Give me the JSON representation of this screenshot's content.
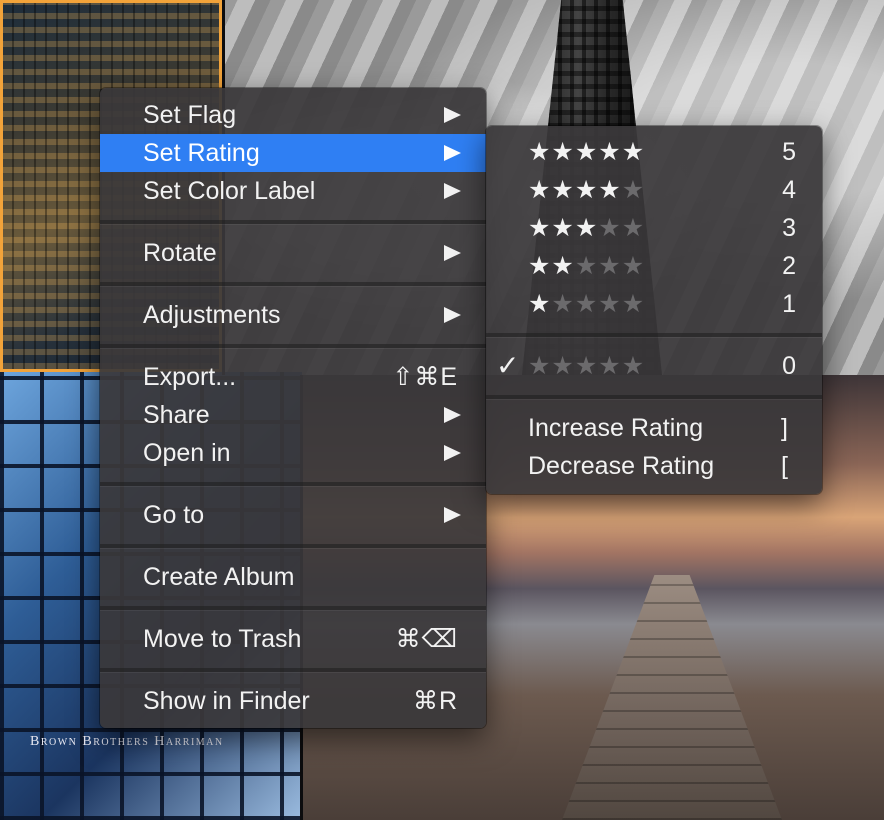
{
  "background": {
    "sign_text": "Brown Brothers Harriman",
    "accent_border": "#f2a33a"
  },
  "context_menu": {
    "items": [
      {
        "label": "Set Flag",
        "submenu": true
      },
      {
        "label": "Set Rating",
        "submenu": true,
        "highlighted": true
      },
      {
        "label": "Set Color Label",
        "submenu": true
      },
      {
        "label": "Rotate",
        "submenu": true
      },
      {
        "label": "Adjustments",
        "submenu": true
      },
      {
        "label": "Export...",
        "shortcut": "⇧⌘E"
      },
      {
        "label": "Share",
        "submenu": true
      },
      {
        "label": "Open in",
        "submenu": true
      },
      {
        "label": "Go to",
        "submenu": true
      },
      {
        "label": "Create Album"
      },
      {
        "label": "Move to Trash",
        "shortcut": "⌘⌫"
      },
      {
        "label": "Show in Finder",
        "shortcut": "⌘R"
      }
    ],
    "highlight_color": "#2f7ff3"
  },
  "rating_submenu": {
    "ratings": [
      {
        "value": "5",
        "filled": 5
      },
      {
        "value": "4",
        "filled": 4
      },
      {
        "value": "3",
        "filled": 3
      },
      {
        "value": "2",
        "filled": 2
      },
      {
        "value": "1",
        "filled": 1
      }
    ],
    "zero": {
      "value": "0",
      "filled": 0,
      "checked": true,
      "check_glyph": "✓"
    },
    "increase": {
      "label": "Increase Rating",
      "key": "]"
    },
    "decrease": {
      "label": "Decrease Rating",
      "key": "["
    },
    "star_glyph": "★"
  }
}
